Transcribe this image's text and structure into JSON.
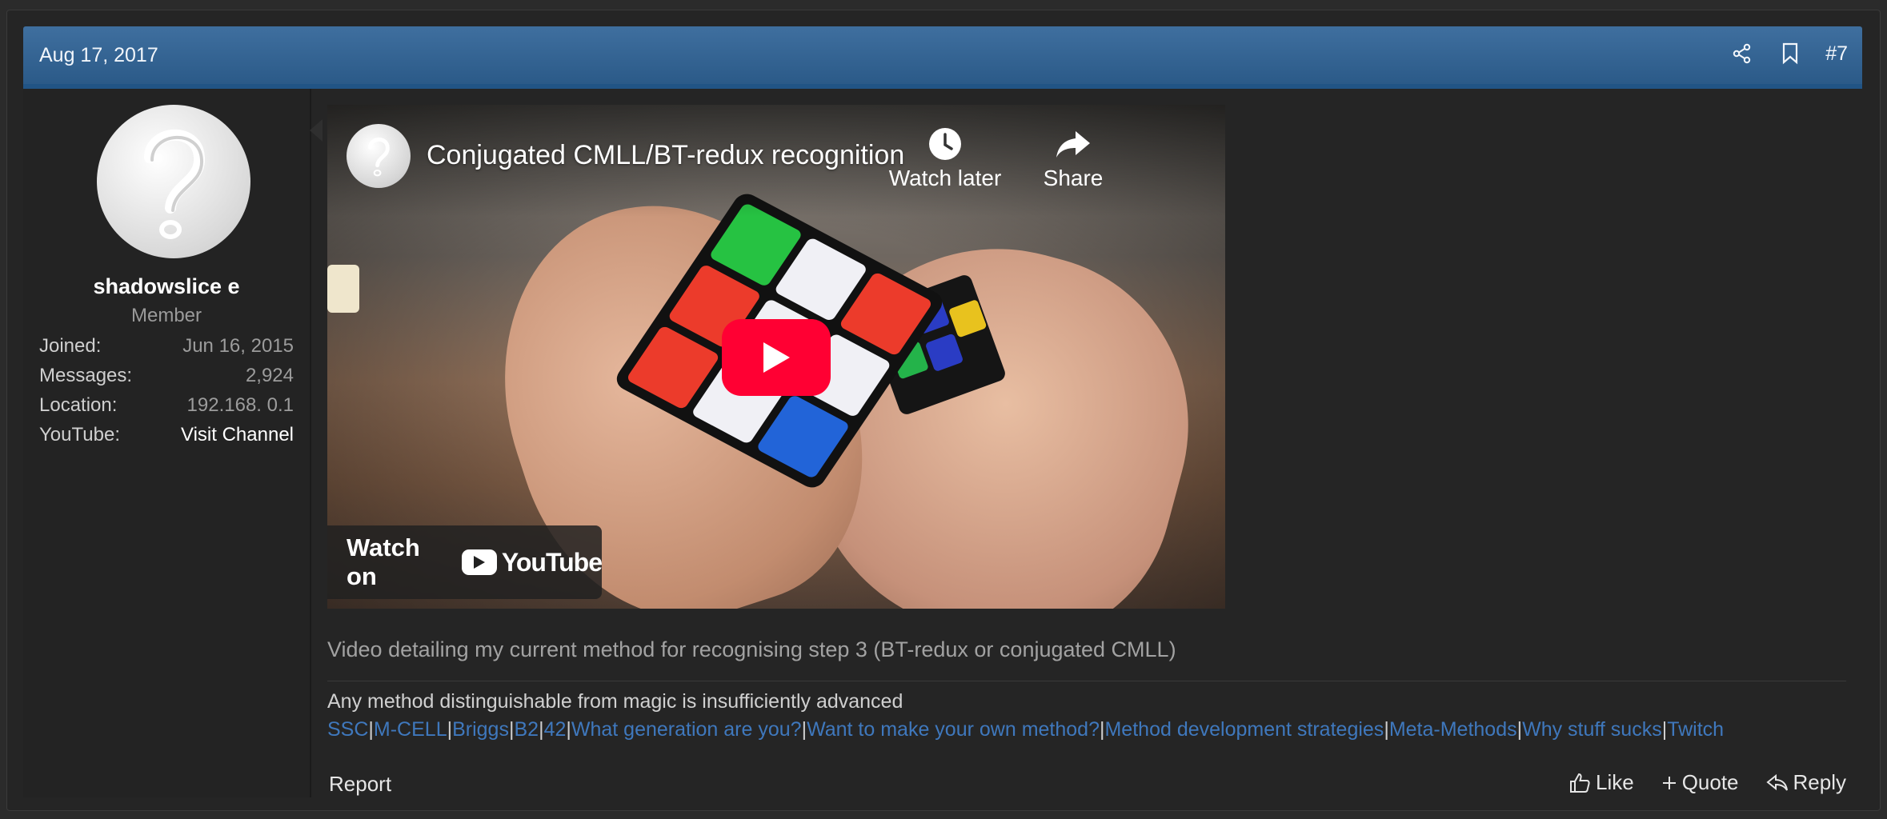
{
  "post": {
    "date": "Aug 17, 2017",
    "number": "#7",
    "header_icons": [
      "share-icon",
      "bookmark-icon"
    ]
  },
  "user": {
    "name": "shadowslice e",
    "title": "Member",
    "stats": [
      {
        "label": "Joined:",
        "value": "Jun 16, 2015"
      },
      {
        "label": "Messages:",
        "value": "2,924"
      },
      {
        "label": "Location:",
        "value": "192.168. 0.1"
      },
      {
        "label": "YouTube:",
        "value": "Visit Channel"
      }
    ]
  },
  "video": {
    "title": "Conjugated CMLL/BT-redux recognition",
    "watch_later": "Watch later",
    "share": "Share",
    "watch_on": "Watch on",
    "youtube_wordmark": "YouTube"
  },
  "caption": "Video detailing my current method for recognising step 3 (BT-redux or conjugated CMLL)",
  "signature": {
    "text": "Any method distinguishable from magic is insufficiently advanced",
    "links": [
      "SSC",
      "M-CELL",
      "Briggs",
      "B2",
      "42",
      "What generation are you?",
      "Want to make your own method?",
      "Method development strategies",
      "Meta-Methods",
      "Why stuff sucks",
      "Twitch"
    ],
    "separator": "|"
  },
  "footer": {
    "report": "Report",
    "like": "Like",
    "quote": "Quote",
    "reply": "Reply"
  },
  "colors": {
    "header_bg": "#3f6f9f",
    "link": "#3f78bd",
    "youtube_red": "#ff0033"
  }
}
